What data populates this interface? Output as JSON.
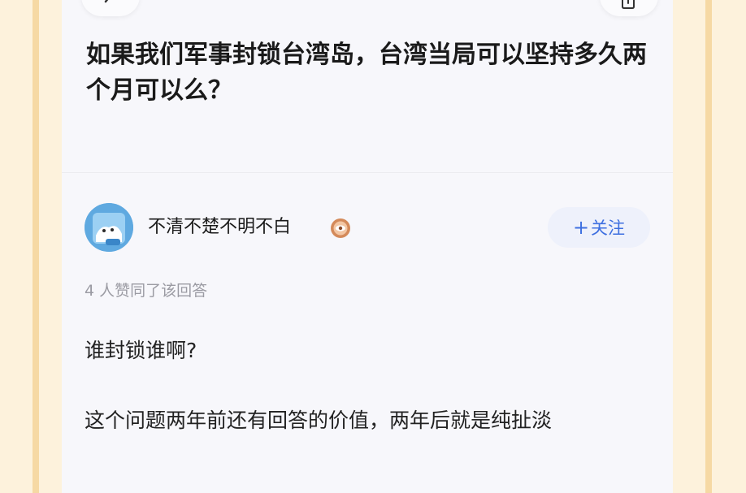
{
  "question": {
    "title": "如果我们军事封锁台湾岛，台湾当局可以坚持多久两个月可以么？"
  },
  "answer": {
    "author_name": "不清不楚不明不白",
    "follow_label": "关注",
    "likes_text": "4 人赞同了该回答",
    "paragraphs": [
      "谁封锁谁啊?",
      "这个问题两年前还有回答的价值，两年后就是纯扯淡"
    ]
  },
  "icons": {
    "back": "chevron-left-icon",
    "share": "share-icon",
    "badge": "eye-badge-icon",
    "follow": "plus-icon"
  },
  "colors": {
    "frame": "#f6d9a4",
    "page_bg": "#f7f7fb",
    "accent": "#3d6fe0",
    "follow_bg": "#eef1fb",
    "muted_text": "#9b9ba3",
    "avatar": "#5fa9e0"
  }
}
